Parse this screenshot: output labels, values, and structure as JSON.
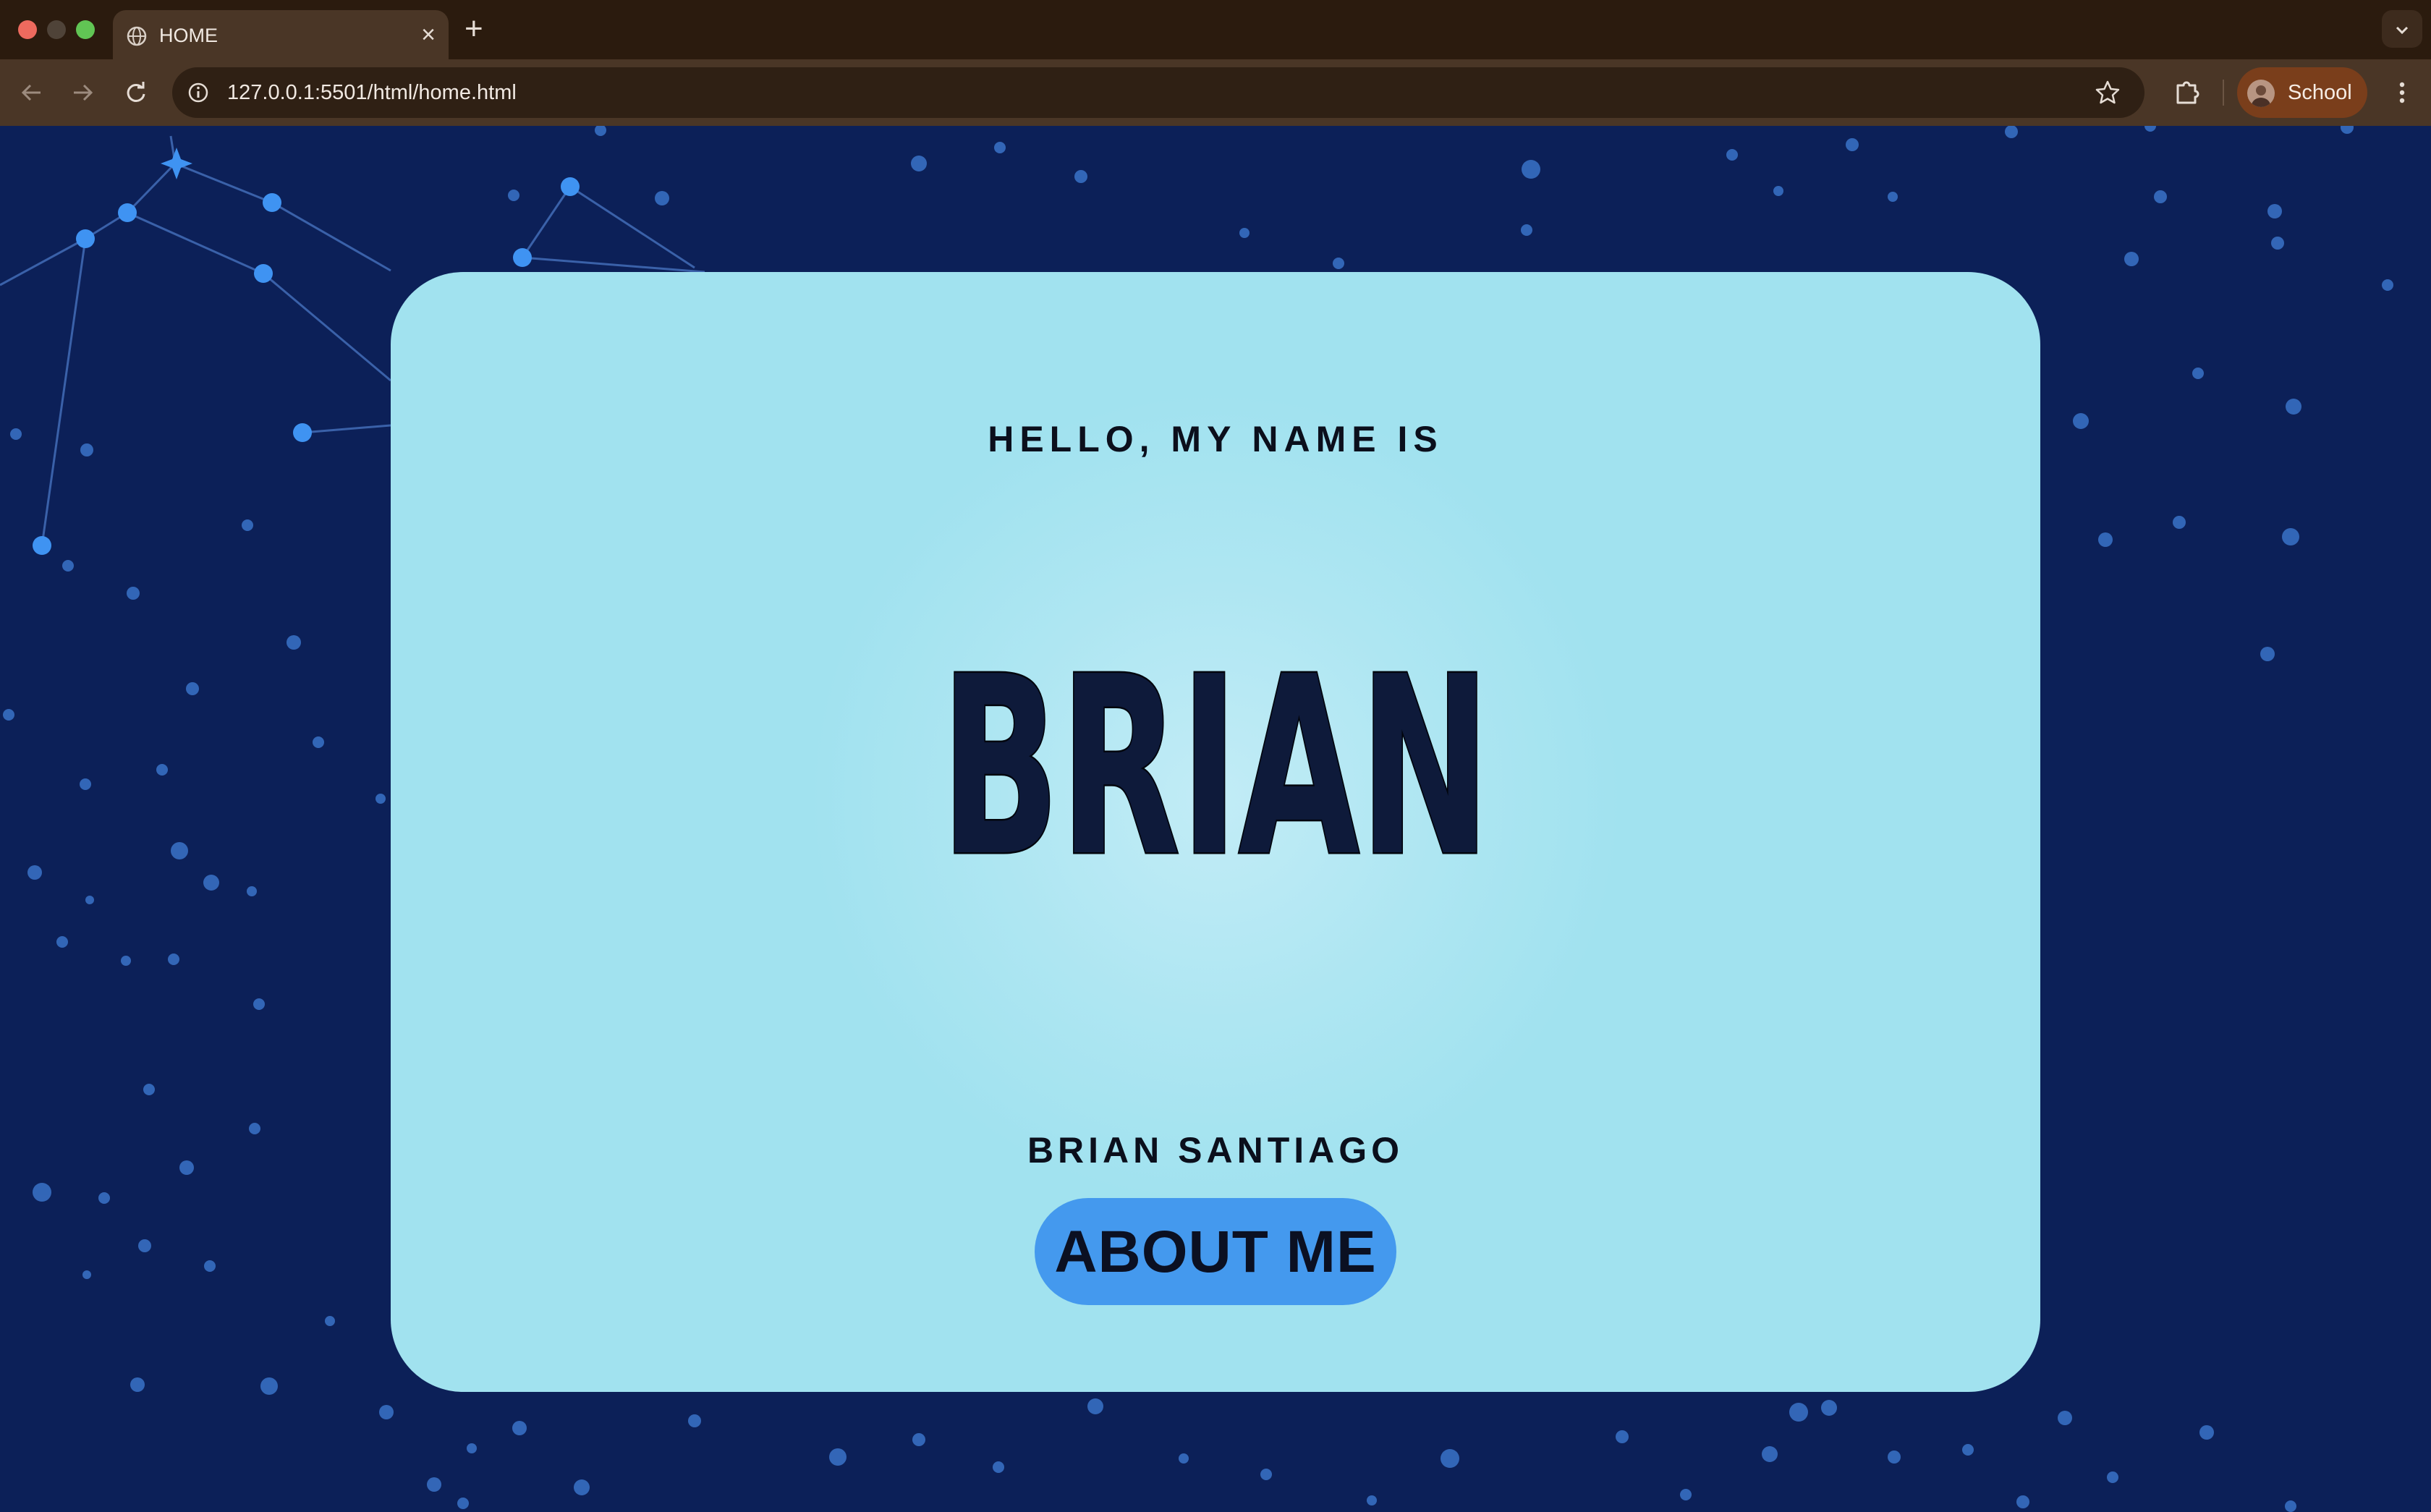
{
  "browser": {
    "tab_title": "HOME",
    "tab_close": "×",
    "new_tab": "+",
    "url": "127.0.0.1:5501/html/home.html",
    "profile_name": "School",
    "icons": [
      "globe-icon",
      "close-icon",
      "plus-icon",
      "chevron-down-icon",
      "back-arrow-icon",
      "forward-arrow-icon",
      "reload-icon",
      "info-icon",
      "bookmark-star-icon",
      "extensions-puzzle-icon",
      "avatar",
      "kebab-menu-icon"
    ]
  },
  "page": {
    "greeting": "HELLO, MY NAME IS",
    "name_display": "BRIAN",
    "full_name": "BRIAN SANTIAGO",
    "about_button": "ABOUT ME"
  },
  "colors": {
    "background": "#0c2058",
    "card": "#a1e2ef",
    "button": "#4499ee",
    "name_fill": "#0e1a3a",
    "star": "#3a8ff0"
  }
}
